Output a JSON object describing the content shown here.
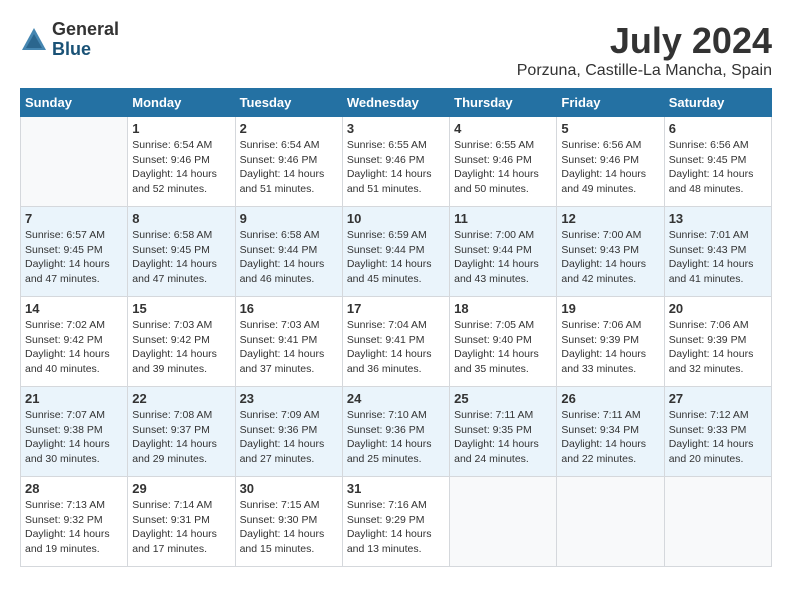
{
  "logo": {
    "general": "General",
    "blue": "Blue"
  },
  "title": "July 2024",
  "location": "Porzuna, Castille-La Mancha, Spain",
  "days_of_week": [
    "Sunday",
    "Monday",
    "Tuesday",
    "Wednesday",
    "Thursday",
    "Friday",
    "Saturday"
  ],
  "weeks": [
    [
      {
        "day": "",
        "sunrise": "",
        "sunset": "",
        "daylight": ""
      },
      {
        "day": "1",
        "sunrise": "Sunrise: 6:54 AM",
        "sunset": "Sunset: 9:46 PM",
        "daylight": "Daylight: 14 hours and 52 minutes."
      },
      {
        "day": "2",
        "sunrise": "Sunrise: 6:54 AM",
        "sunset": "Sunset: 9:46 PM",
        "daylight": "Daylight: 14 hours and 51 minutes."
      },
      {
        "day": "3",
        "sunrise": "Sunrise: 6:55 AM",
        "sunset": "Sunset: 9:46 PM",
        "daylight": "Daylight: 14 hours and 51 minutes."
      },
      {
        "day": "4",
        "sunrise": "Sunrise: 6:55 AM",
        "sunset": "Sunset: 9:46 PM",
        "daylight": "Daylight: 14 hours and 50 minutes."
      },
      {
        "day": "5",
        "sunrise": "Sunrise: 6:56 AM",
        "sunset": "Sunset: 9:46 PM",
        "daylight": "Daylight: 14 hours and 49 minutes."
      },
      {
        "day": "6",
        "sunrise": "Sunrise: 6:56 AM",
        "sunset": "Sunset: 9:45 PM",
        "daylight": "Daylight: 14 hours and 48 minutes."
      }
    ],
    [
      {
        "day": "7",
        "sunrise": "Sunrise: 6:57 AM",
        "sunset": "Sunset: 9:45 PM",
        "daylight": "Daylight: 14 hours and 47 minutes."
      },
      {
        "day": "8",
        "sunrise": "Sunrise: 6:58 AM",
        "sunset": "Sunset: 9:45 PM",
        "daylight": "Daylight: 14 hours and 47 minutes."
      },
      {
        "day": "9",
        "sunrise": "Sunrise: 6:58 AM",
        "sunset": "Sunset: 9:44 PM",
        "daylight": "Daylight: 14 hours and 46 minutes."
      },
      {
        "day": "10",
        "sunrise": "Sunrise: 6:59 AM",
        "sunset": "Sunset: 9:44 PM",
        "daylight": "Daylight: 14 hours and 45 minutes."
      },
      {
        "day": "11",
        "sunrise": "Sunrise: 7:00 AM",
        "sunset": "Sunset: 9:44 PM",
        "daylight": "Daylight: 14 hours and 43 minutes."
      },
      {
        "day": "12",
        "sunrise": "Sunrise: 7:00 AM",
        "sunset": "Sunset: 9:43 PM",
        "daylight": "Daylight: 14 hours and 42 minutes."
      },
      {
        "day": "13",
        "sunrise": "Sunrise: 7:01 AM",
        "sunset": "Sunset: 9:43 PM",
        "daylight": "Daylight: 14 hours and 41 minutes."
      }
    ],
    [
      {
        "day": "14",
        "sunrise": "Sunrise: 7:02 AM",
        "sunset": "Sunset: 9:42 PM",
        "daylight": "Daylight: 14 hours and 40 minutes."
      },
      {
        "day": "15",
        "sunrise": "Sunrise: 7:03 AM",
        "sunset": "Sunset: 9:42 PM",
        "daylight": "Daylight: 14 hours and 39 minutes."
      },
      {
        "day": "16",
        "sunrise": "Sunrise: 7:03 AM",
        "sunset": "Sunset: 9:41 PM",
        "daylight": "Daylight: 14 hours and 37 minutes."
      },
      {
        "day": "17",
        "sunrise": "Sunrise: 7:04 AM",
        "sunset": "Sunset: 9:41 PM",
        "daylight": "Daylight: 14 hours and 36 minutes."
      },
      {
        "day": "18",
        "sunrise": "Sunrise: 7:05 AM",
        "sunset": "Sunset: 9:40 PM",
        "daylight": "Daylight: 14 hours and 35 minutes."
      },
      {
        "day": "19",
        "sunrise": "Sunrise: 7:06 AM",
        "sunset": "Sunset: 9:39 PM",
        "daylight": "Daylight: 14 hours and 33 minutes."
      },
      {
        "day": "20",
        "sunrise": "Sunrise: 7:06 AM",
        "sunset": "Sunset: 9:39 PM",
        "daylight": "Daylight: 14 hours and 32 minutes."
      }
    ],
    [
      {
        "day": "21",
        "sunrise": "Sunrise: 7:07 AM",
        "sunset": "Sunset: 9:38 PM",
        "daylight": "Daylight: 14 hours and 30 minutes."
      },
      {
        "day": "22",
        "sunrise": "Sunrise: 7:08 AM",
        "sunset": "Sunset: 9:37 PM",
        "daylight": "Daylight: 14 hours and 29 minutes."
      },
      {
        "day": "23",
        "sunrise": "Sunrise: 7:09 AM",
        "sunset": "Sunset: 9:36 PM",
        "daylight": "Daylight: 14 hours and 27 minutes."
      },
      {
        "day": "24",
        "sunrise": "Sunrise: 7:10 AM",
        "sunset": "Sunset: 9:36 PM",
        "daylight": "Daylight: 14 hours and 25 minutes."
      },
      {
        "day": "25",
        "sunrise": "Sunrise: 7:11 AM",
        "sunset": "Sunset: 9:35 PM",
        "daylight": "Daylight: 14 hours and 24 minutes."
      },
      {
        "day": "26",
        "sunrise": "Sunrise: 7:11 AM",
        "sunset": "Sunset: 9:34 PM",
        "daylight": "Daylight: 14 hours and 22 minutes."
      },
      {
        "day": "27",
        "sunrise": "Sunrise: 7:12 AM",
        "sunset": "Sunset: 9:33 PM",
        "daylight": "Daylight: 14 hours and 20 minutes."
      }
    ],
    [
      {
        "day": "28",
        "sunrise": "Sunrise: 7:13 AM",
        "sunset": "Sunset: 9:32 PM",
        "daylight": "Daylight: 14 hours and 19 minutes."
      },
      {
        "day": "29",
        "sunrise": "Sunrise: 7:14 AM",
        "sunset": "Sunset: 9:31 PM",
        "daylight": "Daylight: 14 hours and 17 minutes."
      },
      {
        "day": "30",
        "sunrise": "Sunrise: 7:15 AM",
        "sunset": "Sunset: 9:30 PM",
        "daylight": "Daylight: 14 hours and 15 minutes."
      },
      {
        "day": "31",
        "sunrise": "Sunrise: 7:16 AM",
        "sunset": "Sunset: 9:29 PM",
        "daylight": "Daylight: 14 hours and 13 minutes."
      },
      {
        "day": "",
        "sunrise": "",
        "sunset": "",
        "daylight": ""
      },
      {
        "day": "",
        "sunrise": "",
        "sunset": "",
        "daylight": ""
      },
      {
        "day": "",
        "sunrise": "",
        "sunset": "",
        "daylight": ""
      }
    ]
  ]
}
